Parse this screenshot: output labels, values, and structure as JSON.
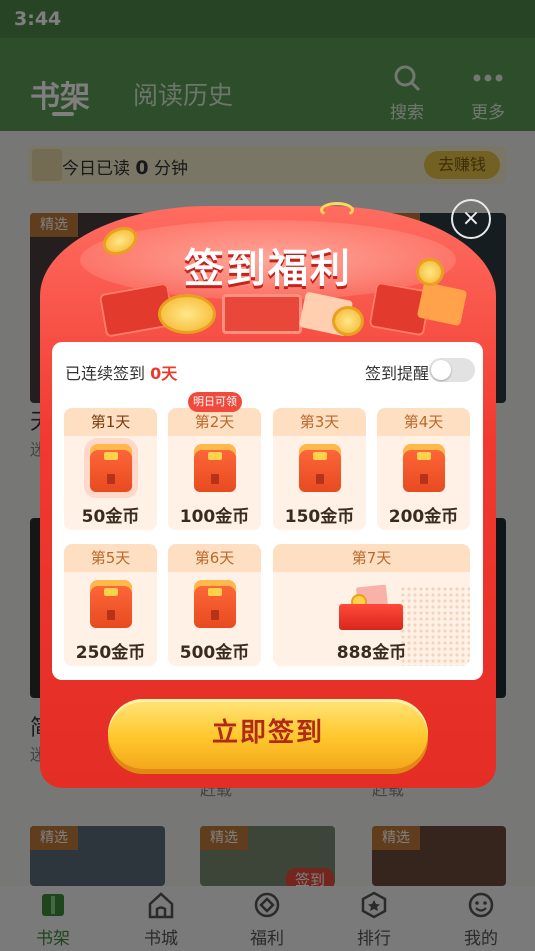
{
  "status_bar": {
    "time": "3:44"
  },
  "header": {
    "tabs": [
      {
        "label": "书架"
      },
      {
        "label": "阅读历史"
      }
    ],
    "search_label": "搜索",
    "more_label": "更多"
  },
  "reading": {
    "prefix": "今日已读",
    "minutes": "0",
    "suffix": "分钟",
    "earn_button": "去赚钱"
  },
  "shelf": {
    "tag": "精选",
    "peek_titles": [
      "天",
      "迷",
      "简",
      "迷",
      "赶载",
      "赶载"
    ],
    "sign_badge": "签到"
  },
  "modal": {
    "title": "签到福利",
    "close_icon": "×",
    "streak_prefix": "已连续签到",
    "streak_value": "0天",
    "reminder_label": "签到提醒",
    "reminder_on": false,
    "tomorrow_badge": "明日可领",
    "days": [
      {
        "label": "第1天",
        "reward": "50金币"
      },
      {
        "label": "第2天",
        "reward": "100金币"
      },
      {
        "label": "第3天",
        "reward": "150金币"
      },
      {
        "label": "第4天",
        "reward": "200金币"
      },
      {
        "label": "第5天",
        "reward": "250金币"
      },
      {
        "label": "第6天",
        "reward": "500金币"
      },
      {
        "label": "第7天",
        "reward": "888金币"
      }
    ],
    "sign_button": "立即签到"
  },
  "bottom_nav": [
    {
      "label": "书架",
      "icon": "bookshelf-icon",
      "active": true
    },
    {
      "label": "书城",
      "icon": "home-icon",
      "active": false
    },
    {
      "label": "福利",
      "icon": "gift-diamond-icon",
      "active": false
    },
    {
      "label": "排行",
      "icon": "ranking-star-icon",
      "active": false
    },
    {
      "label": "我的",
      "icon": "smiley-face-icon",
      "active": false
    }
  ],
  "colors": {
    "header_green": "#5c9a55",
    "modal_red": "#f1392f",
    "button_yellow": "#ffc72c",
    "accent_red": "#e93a2e"
  }
}
